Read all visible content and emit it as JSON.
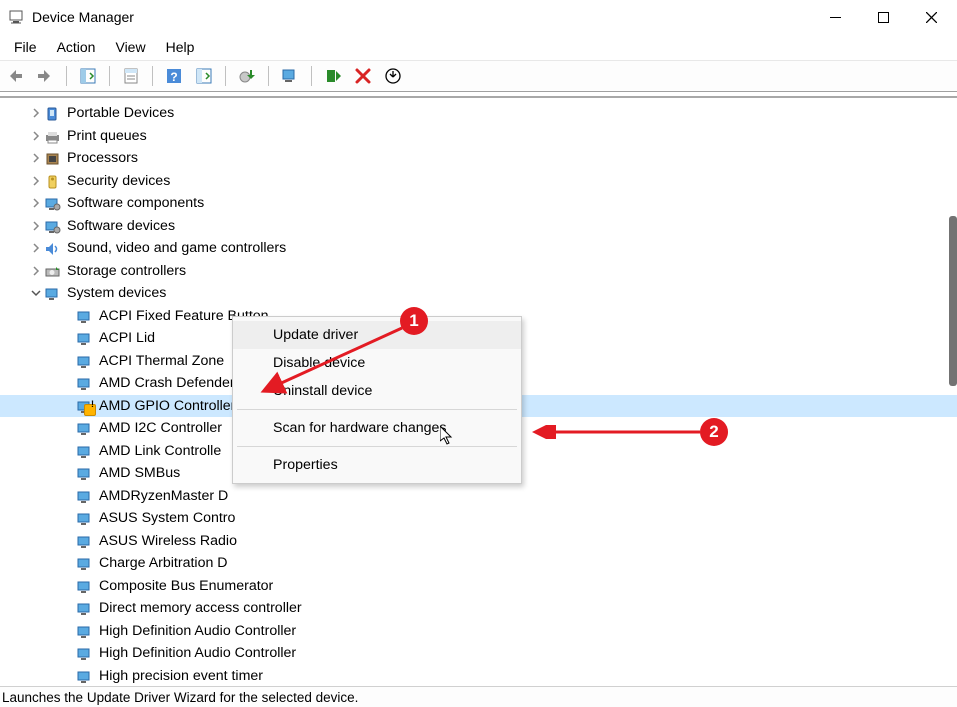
{
  "window": {
    "title": "Device Manager"
  },
  "menu": {
    "file": "File",
    "action": "Action",
    "view": "View",
    "help": "Help"
  },
  "tree": {
    "categories": [
      {
        "icon": "portable",
        "label": "Portable Devices",
        "expanded": false
      },
      {
        "icon": "print",
        "label": "Print queues",
        "expanded": false
      },
      {
        "icon": "proc",
        "label": "Processors",
        "expanded": false
      },
      {
        "icon": "security",
        "label": "Security devices",
        "expanded": false
      },
      {
        "icon": "software",
        "label": "Software components",
        "expanded": false
      },
      {
        "icon": "software",
        "label": "Software devices",
        "expanded": false
      },
      {
        "icon": "sound",
        "label": "Sound, video and game controllers",
        "expanded": false
      },
      {
        "icon": "storage",
        "label": "Storage controllers",
        "expanded": false
      },
      {
        "icon": "system",
        "label": "System devices",
        "expanded": true
      }
    ],
    "system_children": [
      {
        "label": "ACPI Fixed Feature Button",
        "warn": false
      },
      {
        "label": "ACPI Lid",
        "warn": false
      },
      {
        "label": "ACPI Thermal Zone",
        "warn": false
      },
      {
        "label": "AMD Crash Defender",
        "warn": false
      },
      {
        "label": "AMD GPIO Controller",
        "warn": true,
        "selected": true
      },
      {
        "label": "AMD I2C Controller",
        "warn": false
      },
      {
        "label": "AMD Link Controlle",
        "warn": false
      },
      {
        "label": "AMD SMBus",
        "warn": false
      },
      {
        "label": "AMDRyzenMaster D",
        "warn": false
      },
      {
        "label": "ASUS System Contro",
        "warn": false
      },
      {
        "label": "ASUS Wireless Radio",
        "warn": false
      },
      {
        "label": "Charge Arbitration D",
        "warn": false
      },
      {
        "label": "Composite Bus Enumerator",
        "warn": false
      },
      {
        "label": "Direct memory access controller",
        "warn": false
      },
      {
        "label": "High Definition Audio Controller",
        "warn": false
      },
      {
        "label": "High Definition Audio Controller",
        "warn": false
      },
      {
        "label": "High precision event timer",
        "warn": false
      }
    ]
  },
  "context_menu": {
    "update": "Update driver",
    "disable": "Disable device",
    "uninstall": "Uninstall device",
    "scan": "Scan for hardware changes",
    "properties": "Properties"
  },
  "annotations": {
    "badge1": "1",
    "badge2": "2"
  },
  "statusbar": {
    "text": "Launches the Update Driver Wizard for the selected device."
  }
}
